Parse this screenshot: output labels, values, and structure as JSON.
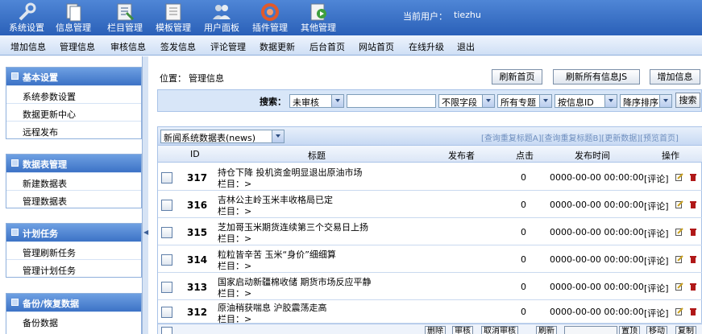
{
  "toolbar": {
    "items": [
      {
        "label": "系统设置",
        "icon": "wrench-icon"
      },
      {
        "label": "信息管理",
        "icon": "documents-icon"
      },
      {
        "label": "栏目管理",
        "icon": "column-manage-icon"
      },
      {
        "label": "模板管理",
        "icon": "template-icon"
      },
      {
        "label": "用户面板",
        "icon": "users-icon"
      },
      {
        "label": "插件管理",
        "icon": "plugin-icon"
      },
      {
        "label": "其他管理",
        "icon": "other-manage-icon"
      }
    ],
    "user_label": "当前用户：",
    "user_name": "tiezhu"
  },
  "menu": [
    "增加信息",
    "管理信息",
    "审核信息",
    "签发信息",
    "评论管理",
    "数据更新",
    "后台首页",
    "网站首页",
    "在线升级",
    "退出"
  ],
  "sidebar": {
    "groups": [
      {
        "title": "基本设置",
        "items": [
          "系统参数设置",
          "数据更新中心",
          "远程发布"
        ]
      },
      {
        "title": "数据表管理",
        "items": [
          "新建数据表",
          "管理数据表"
        ]
      },
      {
        "title": "计划任务",
        "items": [
          "管理刷新任务",
          "管理计划任务"
        ]
      },
      {
        "title": "备份/恢复数据",
        "items": [
          "备份数据"
        ]
      }
    ]
  },
  "main": {
    "position_label": "位置：",
    "position_value": "管理信息",
    "buttons": {
      "refresh_home": "刷新首页",
      "refresh_all_js": "刷新所有信息JS",
      "add_info": "增加信息"
    },
    "search": {
      "label": "搜索：",
      "status": "未审核",
      "keyword": "",
      "field": "不限字段",
      "topic": "所有专题",
      "sort_by": "按信息ID",
      "order": "降序排序",
      "button": "搜索"
    },
    "table_select": "新闻系统数据表(news)",
    "links": [
      "[查询重复标题A]",
      "[查询重复标题B]",
      "[更新数据]",
      "[预览首页]"
    ],
    "columns": {
      "id": "ID",
      "title": "标题",
      "publisher": "发布者",
      "clicks": "点击",
      "time": "发布时间",
      "ops": "操作"
    },
    "rows": [
      {
        "id": "317",
        "title": "持仓下降 投机资金明显退出原油市场",
        "column": "栏目：>",
        "publisher": "",
        "clicks": "0",
        "time": "0000-00-00 00:00:00",
        "comment": "[评论]"
      },
      {
        "id": "316",
        "title": "吉林公主岭玉米丰收格局已定",
        "column": "栏目：>",
        "publisher": "",
        "clicks": "0",
        "time": "0000-00-00 00:00:00",
        "comment": "[评论]"
      },
      {
        "id": "315",
        "title": "芝加哥玉米期货连续第三个交易日上扬",
        "column": "栏目：>",
        "publisher": "",
        "clicks": "0",
        "time": "0000-00-00 00:00:00",
        "comment": "[评论]"
      },
      {
        "id": "314",
        "title": "粒粒皆辛苦 玉米“身价”细细算",
        "column": "栏目：>",
        "publisher": "",
        "clicks": "0",
        "time": "0000-00-00 00:00:00",
        "comment": "[评论]"
      },
      {
        "id": "313",
        "title": "国家启动新疆棉收储 期货市场反应平静",
        "column": "栏目：>",
        "publisher": "",
        "clicks": "0",
        "time": "0000-00-00 00:00:00",
        "comment": "[评论]"
      },
      {
        "id": "312",
        "title": "原油稍获喘息 沪胶震荡走高",
        "column": "栏目：>",
        "publisher": "",
        "clicks": "0",
        "time": "0000-00-00 00:00:00",
        "comment": "[评论]"
      }
    ],
    "bottom_buttons": [
      "删除",
      "审核",
      "取消审核",
      "刷新",
      "移动",
      "复制"
    ],
    "bottom_select": "",
    "bottom_extra": "置顶"
  },
  "colors": {
    "toolbar_blue": "#2a60b8",
    "panel_blue": "#d8e6f8",
    "accent": "#3c72c6"
  }
}
